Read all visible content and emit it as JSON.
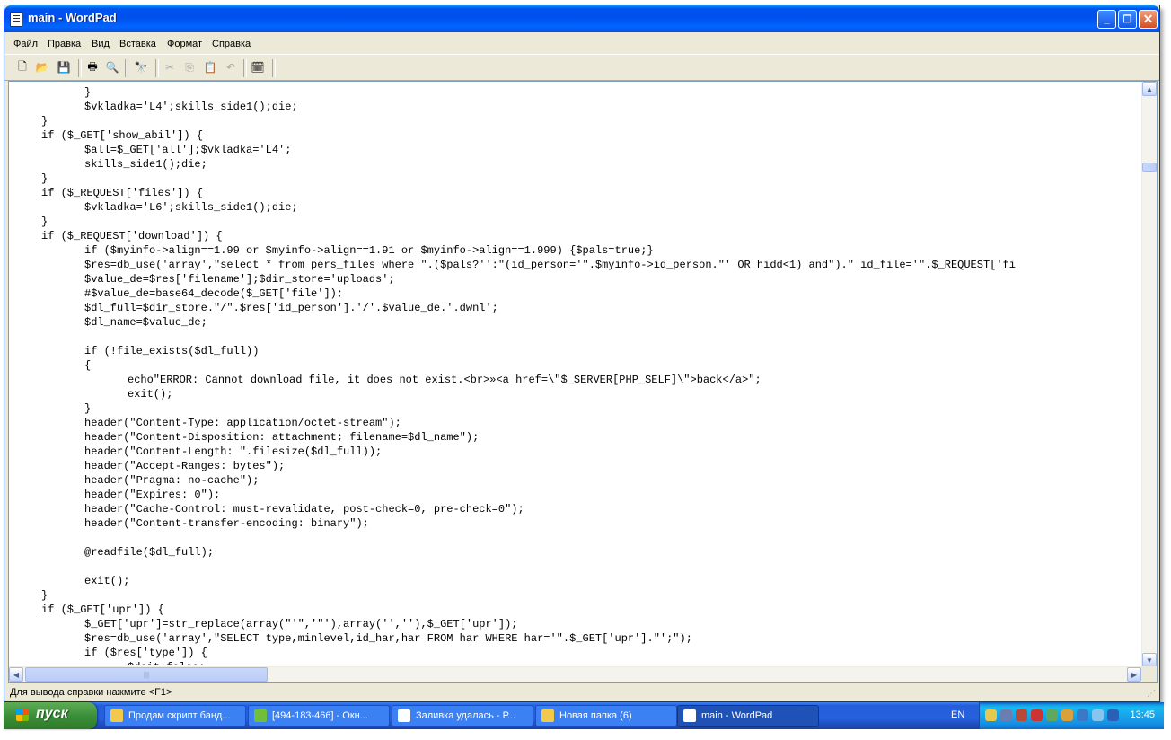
{
  "window": {
    "title": "main - WordPad"
  },
  "menu": [
    "Файл",
    "Правка",
    "Вид",
    "Вставка",
    "Формат",
    "Справка"
  ],
  "toolbar": {
    "icons": [
      "new-document-icon",
      "open-folder-icon",
      "save-icon",
      "print-icon",
      "print-preview-icon",
      "find-icon",
      "cut-icon",
      "copy-icon",
      "paste-icon",
      "undo-icon",
      "insert-datetime-icon"
    ]
  },
  "document": {
    "lines": [
      {
        "indent": 12,
        "text": "}"
      },
      {
        "indent": 12,
        "text": "$vkladka='L4';skills_side1();die;"
      },
      {
        "indent": 6,
        "text": "}"
      },
      {
        "indent": 6,
        "text": "if ($_GET['show_abil']) {"
      },
      {
        "indent": 12,
        "text": "$all=$_GET['all'];$vkladka='L4';"
      },
      {
        "indent": 12,
        "text": "skills_side1();die;"
      },
      {
        "indent": 6,
        "text": "}"
      },
      {
        "indent": 6,
        "text": "if ($_REQUEST['files']) {"
      },
      {
        "indent": 12,
        "text": "$vkladka='L6';skills_side1();die;"
      },
      {
        "indent": 6,
        "text": "}"
      },
      {
        "indent": 6,
        "text": "if ($_REQUEST['download']) {"
      },
      {
        "indent": 12,
        "text": "if ($myinfo->align==1.99 or $myinfo->align==1.91 or $myinfo->align==1.999) {$pals=true;}"
      },
      {
        "indent": 12,
        "text": "$res=db_use('array',\"select * from pers_files where \".($pals?'':\"(id_person='\".$myinfo->id_person.\"' OR hidd<1) and\").\" id_file='\".$_REQUEST['fi"
      },
      {
        "indent": 12,
        "text": "$value_de=$res['filename'];$dir_store='uploads';"
      },
      {
        "indent": 12,
        "text": "#$value_de=base64_decode($_GET['file']);"
      },
      {
        "indent": 12,
        "text": "$dl_full=$dir_store.\"/\".$res['id_person'].'/'.$value_de.'.dwnl';"
      },
      {
        "indent": 12,
        "text": "$dl_name=$value_de;"
      },
      {
        "indent": 0,
        "text": ""
      },
      {
        "indent": 12,
        "text": "if (!file_exists($dl_full))"
      },
      {
        "indent": 12,
        "text": "{"
      },
      {
        "indent": 18,
        "text": "echo\"ERROR: Cannot download file, it does not exist.<br>»<a href=\\\"$_SERVER[PHP_SELF]\\\">back</a>\";"
      },
      {
        "indent": 18,
        "text": "exit();"
      },
      {
        "indent": 12,
        "text": "}"
      },
      {
        "indent": 12,
        "text": "header(\"Content-Type: application/octet-stream\");"
      },
      {
        "indent": 12,
        "text": "header(\"Content-Disposition: attachment; filename=$dl_name\");"
      },
      {
        "indent": 12,
        "text": "header(\"Content-Length: \".filesize($dl_full));"
      },
      {
        "indent": 12,
        "text": "header(\"Accept-Ranges: bytes\");"
      },
      {
        "indent": 12,
        "text": "header(\"Pragma: no-cache\");"
      },
      {
        "indent": 12,
        "text": "header(\"Expires: 0\");"
      },
      {
        "indent": 12,
        "text": "header(\"Cache-Control: must-revalidate, post-check=0, pre-check=0\");"
      },
      {
        "indent": 12,
        "text": "header(\"Content-transfer-encoding: binary\");"
      },
      {
        "indent": 0,
        "text": ""
      },
      {
        "indent": 12,
        "text": "@readfile($dl_full);"
      },
      {
        "indent": 0,
        "text": ""
      },
      {
        "indent": 12,
        "text": "exit();"
      },
      {
        "indent": 6,
        "text": "}"
      },
      {
        "indent": 6,
        "text": "if ($_GET['upr']) {"
      },
      {
        "indent": 12,
        "text": "$_GET['upr']=str_replace(array(\"'\",'\"'),array('',''),$_GET['upr']);"
      },
      {
        "indent": 12,
        "text": "$res=db_use('array',\"SELECT type,minlevel,id_har,har FROM har WHERE har='\".$_GET['upr'].\"';\");"
      },
      {
        "indent": 12,
        "text": "if ($res['type']) {"
      },
      {
        "indent": 18,
        "text": "$doit=false;"
      }
    ]
  },
  "status": {
    "text": "Для вывода справки нажмите <F1>"
  },
  "taskbar": {
    "start_label": "пуск",
    "tasks": [
      {
        "label": "Продам скрипт банд...",
        "icon_color": "#f2c94c"
      },
      {
        "label": "[494-183-466] - Окн...",
        "icon_color": "#6fbf3a"
      },
      {
        "label": "Заливка удалась - Р...",
        "icon_color": "#ffffff"
      },
      {
        "label": "Новая папка (6)",
        "icon_color": "#f2c94c"
      },
      {
        "label": "main - WordPad",
        "icon_color": "#ffffff",
        "active": true
      }
    ],
    "language": "EN",
    "tray_icons": [
      "network-icon",
      "monitor-icon",
      "security-icon",
      "antivirus-icon",
      "messenger-icon",
      "update-icon",
      "shield-icon",
      "volume-icon",
      "calendar-icon"
    ],
    "clock": "13:45"
  }
}
